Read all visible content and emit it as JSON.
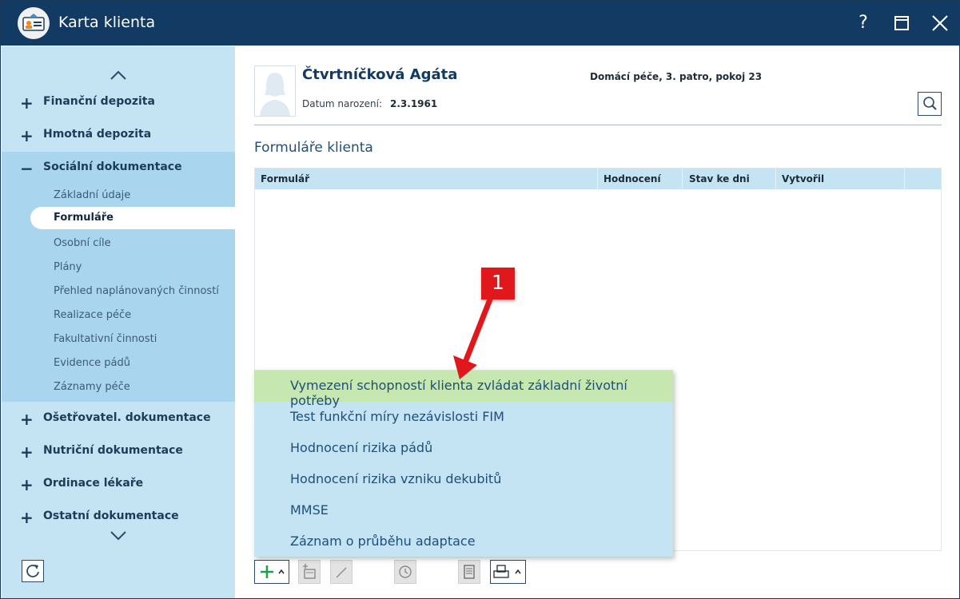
{
  "window": {
    "title": "Karta klienta",
    "help_label": "?"
  },
  "sidebar": {
    "categories": [
      {
        "label": "Finanční depozita"
      },
      {
        "label": "Hmotná depozita"
      },
      {
        "label": "Sociální dokumentace"
      },
      {
        "label": "Ošetřovatel. dokumentace"
      },
      {
        "label": "Nutriční dokumentace"
      },
      {
        "label": "Ordinace lékaře"
      },
      {
        "label": "Ostatní dokumentace"
      }
    ],
    "subitems": [
      {
        "label": "Základní údaje"
      },
      {
        "label": "Formuláře"
      },
      {
        "label": "Osobní cíle"
      },
      {
        "label": "Plány"
      },
      {
        "label": "Přehled naplánovaných činností"
      },
      {
        "label": "Realizace péče"
      },
      {
        "label": "Fakultativní činnosti"
      },
      {
        "label": "Evidence pádů"
      },
      {
        "label": "Záznamy péče"
      }
    ]
  },
  "client": {
    "name": "Čtvrtníčková Agáta",
    "dob_label": "Datum narození:",
    "dob_value": "2.3.1961",
    "location": "Domácí péče, 3. patro, pokoj 23"
  },
  "forms": {
    "title": "Formuláře klienta",
    "columns": [
      "Formulář",
      "Hodnocení",
      "Stav ke dni",
      "Vytvořil"
    ]
  },
  "dropdown": {
    "items": [
      "Vymezení schopností klienta zvládat základní životní potřeby",
      "Test funkční míry nezávislosti FIM",
      "Hodnocení rizika pádů",
      "Hodnocení rizika vzniku dekubitů",
      "MMSE",
      "Záznam o průběhu adaptace"
    ]
  },
  "callout": {
    "label": "1"
  },
  "colors": {
    "titlebar": "#123a62",
    "sidebar": "#c4e3f3",
    "highlight": "#c6e8b0",
    "callout": "#e0181c"
  }
}
